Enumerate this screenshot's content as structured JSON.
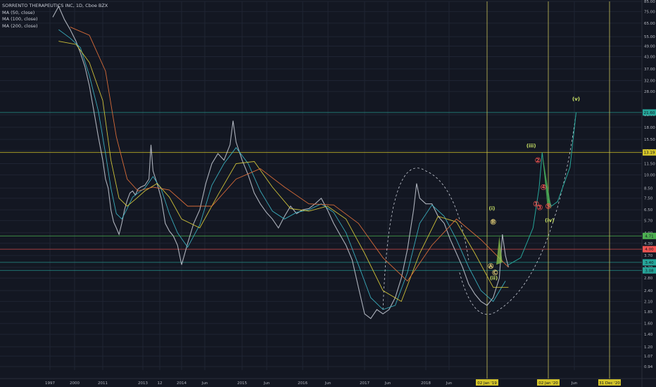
{
  "header": {
    "symbol_line": "SORRENTO THERAPEUTICS INC, 1D, Cboe BZX",
    "ma_items": [
      {
        "label": "MA (50, close)",
        "color": "#3bb3c3"
      },
      {
        "label": "MA (100, close)",
        "color": "#d7c93a"
      },
      {
        "label": "MA (200, close)",
        "color": "#e0703a"
      }
    ]
  },
  "chart_data": {
    "type": "line",
    "title": "SORRENTO THERAPEUTICS INC, 1D, Cboe BZX",
    "y_scale": "log",
    "ylim": [
      0.9,
      85
    ],
    "y_ticks": [
      "85.00",
      "75.00",
      "65.00",
      "55.00",
      "49.00",
      "43.00",
      "37.00",
      "32.00",
      "28.00",
      "21.00",
      "18.00",
      "15.50",
      "13.50",
      "11.50",
      "10.00",
      "8.50",
      "7.50",
      "6.50",
      "5.70",
      "4.90",
      "4.30",
      "3.70",
      "3.20",
      "2.80",
      "2.40",
      "2.10",
      "1.85",
      "1.60",
      "1.40",
      "1.20",
      "1.07",
      "0.94"
    ],
    "x_labels": [
      "1997",
      "2000",
      "2011",
      "2013",
      "12",
      "2014",
      "Jun",
      "2015",
      "Jun",
      "2016",
      "Jun",
      "2017",
      "Jun",
      "2018",
      "Jun",
      "Jun"
    ],
    "price_tags": [
      {
        "label": "21.60",
        "value": 21.6,
        "color": "#26a69a"
      },
      {
        "label": "13.19",
        "value": 13.19,
        "color": "#d4c52a"
      },
      {
        "label": "4.71",
        "value": 4.71,
        "color": "#4caf50"
      },
      {
        "label": "4.00",
        "value": 4.0,
        "color": "#ef5350"
      },
      {
        "label": "3.40",
        "value": 3.4,
        "color": "#26a69a"
      },
      {
        "label": "3.08",
        "value": 3.08,
        "color": "#26a69a"
      }
    ],
    "vertical_markers": [
      {
        "label": "02 Jan '19",
        "x_year": 2019.0
      },
      {
        "label": "02 Jan '20",
        "x_year": 2020.0
      },
      {
        "label": "31 Dec '20",
        "x_year": 2020.99
      }
    ],
    "series": [
      {
        "name": "Price",
        "points": [
          [
            2010.6,
            70
          ],
          [
            2010.7,
            80
          ],
          [
            2010.8,
            68
          ],
          [
            2010.9,
            60
          ],
          [
            2011.0,
            52
          ],
          [
            2011.1,
            45
          ],
          [
            2011.2,
            38
          ],
          [
            2011.3,
            30
          ],
          [
            2011.4,
            22
          ],
          [
            2011.5,
            16
          ],
          [
            2011.6,
            12
          ],
          [
            2011.7,
            9.5
          ],
          [
            2011.8,
            8.5
          ],
          [
            2011.9,
            6.5
          ],
          [
            2012.0,
            5.6
          ],
          [
            2012.1,
            5.2
          ],
          [
            2012.2,
            4.8
          ],
          [
            2012.3,
            5.5
          ],
          [
            2012.4,
            6.5
          ],
          [
            2012.5,
            7.3
          ],
          [
            2012.6,
            8.0
          ],
          [
            2012.7,
            8.2
          ],
          [
            2012.8,
            7.8
          ],
          [
            2012.9,
            8.4
          ],
          [
            2013.0,
            8.6
          ],
          [
            2013.1,
            8.8
          ],
          [
            2013.2,
            9.5
          ],
          [
            2013.25,
            14.5
          ],
          [
            2013.3,
            10.5
          ],
          [
            2013.4,
            9.0
          ],
          [
            2013.5,
            7.5
          ],
          [
            2013.6,
            5.5
          ],
          [
            2013.7,
            5.0
          ],
          [
            2013.8,
            4.7
          ],
          [
            2013.9,
            4.2
          ],
          [
            2014.0,
            3.3
          ],
          [
            2014.1,
            4.3
          ],
          [
            2014.2,
            5.5
          ],
          [
            2014.3,
            6.5
          ],
          [
            2014.4,
            9.0
          ],
          [
            2014.5,
            11.5
          ],
          [
            2014.6,
            13.0
          ],
          [
            2014.7,
            12.0
          ],
          [
            2014.8,
            14.5
          ],
          [
            2014.85,
            19.5
          ],
          [
            2014.9,
            15.0
          ],
          [
            2015.0,
            12.0
          ],
          [
            2015.1,
            10.0
          ],
          [
            2015.2,
            8.0
          ],
          [
            2015.3,
            7.0
          ],
          [
            2015.4,
            6.3
          ],
          [
            2015.5,
            5.8
          ],
          [
            2015.6,
            5.2
          ],
          [
            2015.7,
            6.0
          ],
          [
            2015.8,
            6.8
          ],
          [
            2015.9,
            6.2
          ],
          [
            2016.0,
            6.5
          ],
          [
            2016.1,
            6.6
          ],
          [
            2016.2,
            7.0
          ],
          [
            2016.3,
            7.5
          ],
          [
            2016.4,
            6.5
          ],
          [
            2016.5,
            5.5
          ],
          [
            2016.6,
            4.8
          ],
          [
            2016.7,
            4.2
          ],
          [
            2016.8,
            3.5
          ],
          [
            2016.9,
            2.5
          ],
          [
            2017.0,
            1.8
          ],
          [
            2017.1,
            1.7
          ],
          [
            2017.2,
            1.9
          ],
          [
            2017.3,
            1.8
          ],
          [
            2017.4,
            1.9
          ],
          [
            2017.5,
            2.2
          ],
          [
            2017.6,
            2.8
          ],
          [
            2017.7,
            4.0
          ],
          [
            2017.8,
            6.5
          ],
          [
            2017.85,
            9.0
          ],
          [
            2017.9,
            7.5
          ],
          [
            2018.0,
            7.0
          ],
          [
            2018.1,
            7.0
          ],
          [
            2018.2,
            6.0
          ],
          [
            2018.3,
            5.5
          ],
          [
            2018.4,
            4.5
          ],
          [
            2018.5,
            3.8
          ],
          [
            2018.6,
            3.2
          ],
          [
            2018.7,
            2.6
          ],
          [
            2018.8,
            2.3
          ],
          [
            2018.9,
            2.1
          ],
          [
            2019.0,
            2.0
          ],
          [
            2019.1,
            2.2
          ],
          [
            2019.2,
            2.8
          ],
          [
            2019.25,
            4.8
          ],
          [
            2019.3,
            3.7
          ],
          [
            2019.35,
            3.2
          ]
        ],
        "color": "#c8ccd6"
      },
      {
        "name": "MA (50, close)",
        "points": [
          [
            2010.7,
            60
          ],
          [
            2010.9,
            54
          ],
          [
            2011.1,
            48
          ],
          [
            2011.3,
            34
          ],
          [
            2011.5,
            22
          ],
          [
            2011.7,
            13
          ],
          [
            2011.9,
            8.5
          ],
          [
            2012.1,
            6.2
          ],
          [
            2012.3,
            5.8
          ],
          [
            2012.5,
            6.6
          ],
          [
            2012.7,
            7.6
          ],
          [
            2012.9,
            8.0
          ],
          [
            2013.1,
            8.5
          ],
          [
            2013.3,
            9.8
          ],
          [
            2013.5,
            8.4
          ],
          [
            2013.7,
            6.2
          ],
          [
            2013.9,
            4.9
          ],
          [
            2014.1,
            4.1
          ],
          [
            2014.3,
            5.4
          ],
          [
            2014.5,
            8.8
          ],
          [
            2014.7,
            11.5
          ],
          [
            2014.9,
            14.0
          ],
          [
            2015.1,
            11.5
          ],
          [
            2015.3,
            8.2
          ],
          [
            2015.5,
            6.4
          ],
          [
            2015.7,
            5.8
          ],
          [
            2015.9,
            6.3
          ],
          [
            2016.1,
            6.5
          ],
          [
            2016.3,
            7.0
          ],
          [
            2016.5,
            6.3
          ],
          [
            2016.7,
            4.9
          ],
          [
            2016.9,
            3.3
          ],
          [
            2017.1,
            2.2
          ],
          [
            2017.3,
            1.9
          ],
          [
            2017.5,
            2.0
          ],
          [
            2017.7,
            3.0
          ],
          [
            2017.9,
            5.5
          ],
          [
            2018.1,
            6.9
          ],
          [
            2018.3,
            6.0
          ],
          [
            2018.5,
            4.5
          ],
          [
            2018.7,
            3.2
          ],
          [
            2018.9,
            2.4
          ],
          [
            2019.1,
            2.1
          ],
          [
            2019.3,
            2.7
          ]
        ],
        "color": "#3bb3c3"
      },
      {
        "name": "MA (100, close)",
        "points": [
          [
            2010.7,
            52
          ],
          [
            2011.0,
            50
          ],
          [
            2011.3,
            40
          ],
          [
            2011.6,
            25
          ],
          [
            2011.9,
            12
          ],
          [
            2012.2,
            7.5
          ],
          [
            2012.5,
            6.8
          ],
          [
            2012.8,
            7.4
          ],
          [
            2013.1,
            8.2
          ],
          [
            2013.4,
            9.0
          ],
          [
            2013.7,
            7.6
          ],
          [
            2014.0,
            5.8
          ],
          [
            2014.3,
            5.2
          ],
          [
            2014.6,
            7.8
          ],
          [
            2014.9,
            11.5
          ],
          [
            2015.2,
            11.8
          ],
          [
            2015.5,
            8.6
          ],
          [
            2015.8,
            6.6
          ],
          [
            2016.1,
            6.4
          ],
          [
            2016.4,
            6.8
          ],
          [
            2016.7,
            5.8
          ],
          [
            2017.0,
            3.8
          ],
          [
            2017.3,
            2.4
          ],
          [
            2017.6,
            2.1
          ],
          [
            2017.9,
            3.8
          ],
          [
            2018.2,
            6.0
          ],
          [
            2018.5,
            5.6
          ],
          [
            2018.8,
            3.8
          ],
          [
            2019.1,
            2.5
          ],
          [
            2019.35,
            2.5
          ]
        ],
        "color": "#d7c93a"
      },
      {
        "name": "MA (200, close)",
        "points": [
          [
            2010.9,
            62
          ],
          [
            2011.3,
            56
          ],
          [
            2011.7,
            36
          ],
          [
            2012.1,
            16
          ],
          [
            2012.5,
            9.5
          ],
          [
            2012.9,
            8.2
          ],
          [
            2013.3,
            8.6
          ],
          [
            2013.7,
            8.3
          ],
          [
            2014.1,
            6.8
          ],
          [
            2014.5,
            6.8
          ],
          [
            2014.9,
            9.5
          ],
          [
            2015.3,
            10.8
          ],
          [
            2015.7,
            8.6
          ],
          [
            2016.1,
            7.0
          ],
          [
            2016.5,
            6.9
          ],
          [
            2016.9,
            5.5
          ],
          [
            2017.3,
            3.6
          ],
          [
            2017.7,
            2.7
          ],
          [
            2018.1,
            4.2
          ],
          [
            2018.5,
            5.8
          ],
          [
            2018.9,
            4.5
          ],
          [
            2019.35,
            3.2
          ]
        ],
        "color": "#e0703a"
      }
    ],
    "projection": {
      "color": "#26a69a",
      "points": [
        [
          2019.35,
          3.3
        ],
        [
          2019.55,
          3.6
        ],
        [
          2019.75,
          5.2
        ],
        [
          2019.85,
          8.5
        ],
        [
          2019.9,
          13.19
        ],
        [
          2019.95,
          9.5
        ],
        [
          2020.0,
          7.5
        ],
        [
          2020.05,
          6.8
        ],
        [
          2020.15,
          7.2
        ],
        [
          2020.35,
          11.0
        ],
        [
          2020.45,
          21.6
        ]
      ]
    },
    "wave_labels": [
      {
        "text": "(i)",
        "x_year": 2019.08,
        "value": 6.6,
        "color": "#c9e265"
      },
      {
        "text": "(ii)",
        "x_year": 2019.11,
        "value": 2.8,
        "color": "#c9e265"
      },
      {
        "text": "(iii)",
        "x_year": 2019.72,
        "value": 14.3,
        "color": "#c9e265"
      },
      {
        "text": "(iv)",
        "x_year": 2020.02,
        "value": 5.7,
        "color": "#c9e265"
      },
      {
        "text": "(v)",
        "x_year": 2020.45,
        "value": 25.5,
        "color": "#c9e265"
      },
      {
        "text": "A",
        "x_year": 2019.06,
        "value": 3.25,
        "color": "#e8d37a"
      },
      {
        "text": "B",
        "x_year": 2019.1,
        "value": 5.6,
        "color": "#e8d37a"
      },
      {
        "text": "C",
        "x_year": 2019.13,
        "value": 3.0,
        "color": "#e8d37a"
      },
      {
        "text": "1",
        "x_year": 2019.8,
        "value": 7.0,
        "color": "#ef5350"
      },
      {
        "text": "2",
        "x_year": 2019.83,
        "value": 12.0,
        "color": "#ef5350"
      },
      {
        "text": "3",
        "x_year": 2019.86,
        "value": 6.7,
        "color": "#ef5350"
      },
      {
        "text": "4",
        "x_year": 2019.92,
        "value": 8.6,
        "color": "#ef5350"
      },
      {
        "text": "5",
        "x_year": 2020.0,
        "value": 6.8,
        "color": "#ef5350"
      }
    ]
  }
}
